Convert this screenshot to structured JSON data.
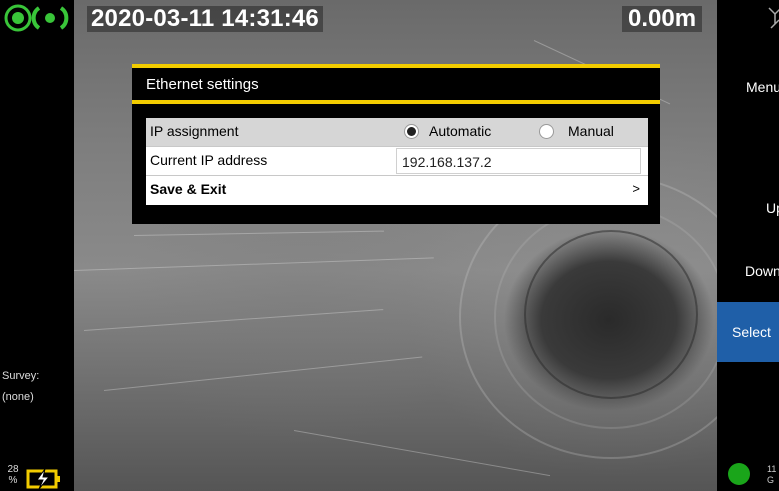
{
  "overlay": {
    "datetime": "2020-03-11 14:31:46",
    "distance": "0.00m"
  },
  "left_panel": {
    "logo_icon": "radiating-signal-logo-icon",
    "survey_label": "Survey:",
    "survey_value": "(none)",
    "battery_percent": "28 %",
    "battery_icon": "battery-charging-icon"
  },
  "right_panel": {
    "top_icon": "antenna-icon",
    "softkeys": {
      "menu": "Menu",
      "up": "Up",
      "down": "Down",
      "select": "Select"
    },
    "status_text": "11 G",
    "colors": {
      "select_bg": "#1f5fa8",
      "status_dot": "#1aa51a"
    }
  },
  "dialog": {
    "title": "Ethernet settings",
    "accent_color": "#f2cc00",
    "rows": {
      "ip_assignment": {
        "label": "IP assignment",
        "options": [
          {
            "label": "Automatic",
            "selected": true
          },
          {
            "label": "Manual",
            "selected": false
          }
        ]
      },
      "current_ip": {
        "label": "Current IP address",
        "value": "192.168.137.2"
      },
      "save": {
        "label": "Save & Exit",
        "chevron": ">"
      }
    }
  }
}
